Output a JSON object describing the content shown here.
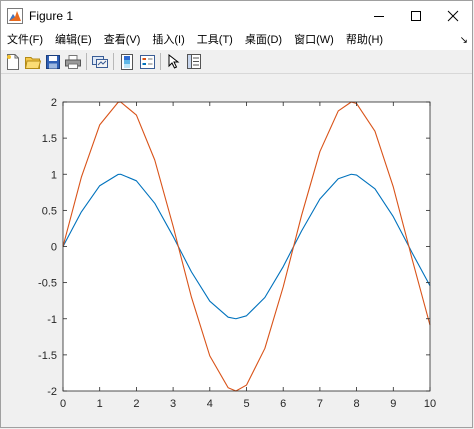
{
  "window": {
    "title": "Figure 1"
  },
  "menu": [
    {
      "label": "文件(F)"
    },
    {
      "label": "编辑(E)"
    },
    {
      "label": "查看(V)"
    },
    {
      "label": "插入(I)"
    },
    {
      "label": "工具(T)"
    },
    {
      "label": "桌面(D)"
    },
    {
      "label": "窗口(W)"
    },
    {
      "label": "帮助(H)"
    }
  ],
  "toolbar": [
    "new-figure-icon",
    "open-folder-icon",
    "save-icon",
    "print-icon",
    "link-plot-icon",
    "insert-colorbar-icon",
    "insert-legend-icon",
    "edit-plot-arrow-icon",
    "property-inspector-icon"
  ],
  "colors": {
    "series1": "#0072BD",
    "series2": "#D95319",
    "axes_bg": "#ffffff"
  },
  "chart_data": {
    "type": "line",
    "xlim": [
      0,
      10
    ],
    "ylim": [
      -2,
      2
    ],
    "x_ticks": [
      0,
      1,
      2,
      3,
      4,
      5,
      6,
      7,
      8,
      9,
      10
    ],
    "y_ticks": [
      -2,
      -1.5,
      -1,
      -0.5,
      0,
      0.5,
      1,
      1.5,
      2
    ],
    "x_tick_labels": [
      "0",
      "1",
      "2",
      "3",
      "4",
      "5",
      "6",
      "7",
      "8",
      "9",
      "10"
    ],
    "y_tick_labels": [
      "-2",
      "-1.5",
      "-1",
      "-0.5",
      "0",
      "0.5",
      "1",
      "1.5",
      "2"
    ],
    "grid": false,
    "series": [
      {
        "color": "#0072BD",
        "x": [
          0,
          0.5,
          1,
          1.5,
          1.571,
          2,
          2.5,
          3,
          3.142,
          3.5,
          4,
          4.5,
          4.712,
          5,
          5.5,
          6,
          6.283,
          6.5,
          7,
          7.5,
          7.854,
          8,
          8.5,
          9,
          9.425,
          9.5,
          10
        ],
        "y": [
          0,
          0.479,
          0.841,
          0.997,
          1,
          0.909,
          0.598,
          0.141,
          0,
          -0.351,
          -0.757,
          -0.978,
          -1,
          -0.959,
          -0.706,
          -0.279,
          0,
          0.215,
          0.657,
          0.938,
          1,
          0.989,
          0.798,
          0.412,
          0,
          -0.075,
          -0.544
        ]
      },
      {
        "color": "#D95319",
        "x": [
          0,
          0.5,
          1,
          1.5,
          1.571,
          2,
          2.5,
          3,
          3.142,
          3.5,
          4,
          4.5,
          4.712,
          5,
          5.5,
          6,
          6.283,
          6.5,
          7,
          7.5,
          7.854,
          8,
          8.5,
          9,
          9.425,
          9.5,
          10
        ],
        "y": [
          0,
          0.959,
          1.683,
          1.995,
          2,
          1.819,
          1.197,
          0.282,
          0,
          -0.702,
          -1.514,
          -1.955,
          -2,
          -1.918,
          -1.411,
          -0.559,
          0,
          0.43,
          1.314,
          1.876,
          2,
          1.979,
          1.596,
          0.824,
          0,
          -0.15,
          -1.088
        ]
      }
    ]
  }
}
